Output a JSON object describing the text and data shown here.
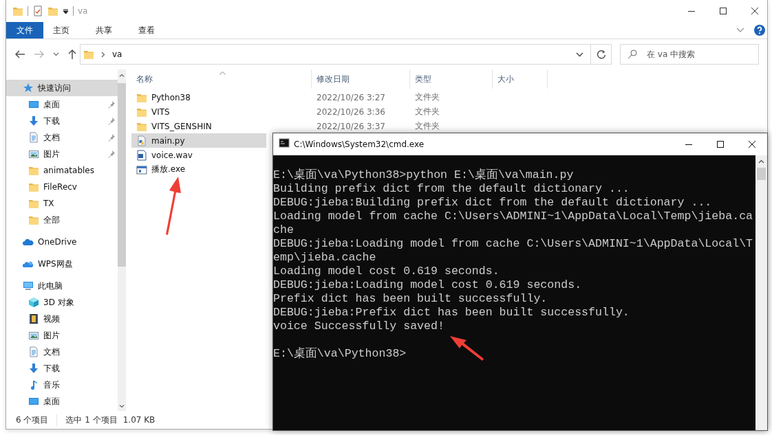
{
  "explorer": {
    "title": "va",
    "ribbon_tabs": [
      {
        "label": "文件",
        "selected": true
      },
      {
        "label": "主页",
        "selected": false
      },
      {
        "label": "共享",
        "selected": false
      },
      {
        "label": "查看",
        "selected": false
      }
    ],
    "address": {
      "path": [
        "va"
      ]
    },
    "search": {
      "placeholder": "在 va 中搜索"
    },
    "sidebar": {
      "items": [
        {
          "label": "快速访问",
          "kind": "star",
          "selected": true,
          "children": [
            {
              "label": "桌面",
              "kind": "desktop",
              "pinned": true,
              "selected": false
            },
            {
              "label": "下载",
              "kind": "download",
              "pinned": true,
              "selected": false
            },
            {
              "label": "文档",
              "kind": "document",
              "pinned": true,
              "selected": false
            },
            {
              "label": "图片",
              "kind": "picture",
              "pinned": true,
              "selected": false
            },
            {
              "label": "animatables",
              "kind": "folder",
              "pinned": false,
              "selected": false
            },
            {
              "label": "FileRecv",
              "kind": "folder",
              "pinned": false,
              "selected": false
            },
            {
              "label": "TX",
              "kind": "folder",
              "pinned": false,
              "selected": false
            },
            {
              "label": "全部",
              "kind": "folder",
              "pinned": false,
              "selected": false
            }
          ]
        },
        {
          "label": "OneDrive",
          "kind": "cloud",
          "selected": false
        },
        {
          "label": "WPS网盘",
          "kind": "clouds",
          "selected": false
        },
        {
          "label": "此电脑",
          "kind": "pc",
          "selected": false,
          "children": [
            {
              "label": "3D 对象",
              "kind": "cube",
              "pinned": false,
              "selected": false
            },
            {
              "label": "视频",
              "kind": "video",
              "pinned": false,
              "selected": false
            },
            {
              "label": "图片",
              "kind": "picture",
              "pinned": false,
              "selected": false
            },
            {
              "label": "文档",
              "kind": "document",
              "pinned": false,
              "selected": false
            },
            {
              "label": "下载",
              "kind": "download",
              "pinned": false,
              "selected": false
            },
            {
              "label": "音乐",
              "kind": "music",
              "pinned": false,
              "selected": false
            },
            {
              "label": "桌面",
              "kind": "desktop",
              "pinned": false,
              "selected": false
            }
          ]
        }
      ]
    },
    "columns": [
      "名称",
      "修改日期",
      "类型",
      "大小"
    ],
    "files": [
      {
        "name": "Python38",
        "kind": "folder",
        "modified": "2022/10/26 3:27",
        "type": "文件夹",
        "selected": false
      },
      {
        "name": "VITS",
        "kind": "folder",
        "modified": "2022/10/26 3:36",
        "type": "文件夹",
        "selected": false
      },
      {
        "name": "VITS_GENSHIN",
        "kind": "folder",
        "modified": "2022/10/26 3:37",
        "type": "文件夹",
        "selected": false
      },
      {
        "name": "main.py",
        "kind": "python",
        "selected": true
      },
      {
        "name": "voice.wav",
        "kind": "audio",
        "selected": false
      },
      {
        "name": "播放.exe",
        "kind": "exe",
        "selected": false
      }
    ],
    "status_bar": {
      "count": "6 个项目",
      "selection": "选中 1 个项目",
      "size": "1.07 KB"
    }
  },
  "console": {
    "title": "C:\\Windows\\System32\\cmd.exe",
    "lines": [
      {
        "text": "E:\\桌面\\va\\Python38>python E:\\桌面\\va\\main.py"
      },
      {
        "text": "Building prefix dict from the default dictionary ..."
      },
      {
        "text": "DEBUG:jieba:Building prefix dict from the default dictionary ..."
      },
      {
        "text": "Loading model from cache C:\\Users\\ADMINI~1\\AppData\\Local\\Temp\\jieba.ca"
      },
      {
        "text": "che"
      },
      {
        "text": "DEBUG:jieba:Loading model from cache C:\\Users\\ADMINI~1\\AppData\\Local\\T"
      },
      {
        "text": "emp\\jieba.cache"
      },
      {
        "text": "Loading model cost 0.619 seconds."
      },
      {
        "text": "DEBUG:jieba:Loading model cost 0.619 seconds."
      },
      {
        "text": "Prefix dict has been built successfully."
      },
      {
        "text": "DEBUG:jieba:Prefix dict has been built successfully."
      },
      {
        "text": "voice Successfully saved!"
      },
      {
        "kind": "blank"
      },
      {
        "text": "E:\\桌面\\va\\Python38>"
      }
    ]
  }
}
